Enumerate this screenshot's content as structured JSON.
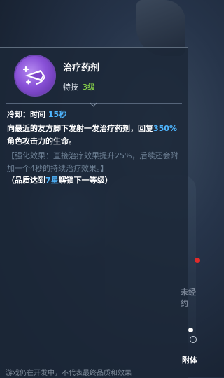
{
  "skill": {
    "name": "治疗药剂",
    "type_label": "特技",
    "level": "3级"
  },
  "cooldown": {
    "label": "冷却：时间",
    "value": "15秒"
  },
  "description": {
    "part1": "向最近的友方脚下发射一发治疗药剂，回复",
    "percent": "350%",
    "part2": "角色攻击力的生命。"
  },
  "enhancement": "【强化效果：直接治疗效果提升25%，后续还会附加一个4秒的持续治疗效果。】",
  "quality_unlock": {
    "prefix": "（品质达到",
    "stars": "7星",
    "suffix": "解锁下一等级）"
  },
  "footer_notice": "游戏仍在开发中，不代表最终品质和效果",
  "side": {
    "unlock_label": "未经约",
    "attach_label": "附体"
  },
  "colors": {
    "accent_blue": "#4fb6ff",
    "level_green": "#8fe04a",
    "icon_purple": "#8a52d8",
    "notification_red": "#e02a2a"
  },
  "icons": {
    "skill": "potion-arrow-icon"
  }
}
